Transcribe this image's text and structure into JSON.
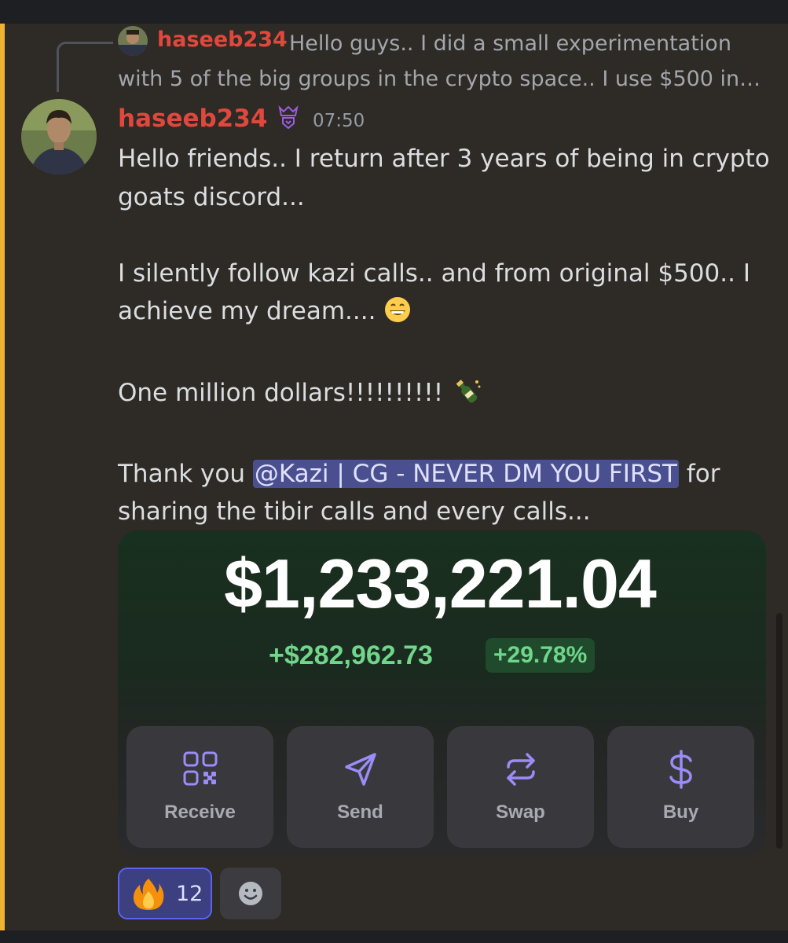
{
  "reply": {
    "author": "haseeb234",
    "text": "Hello guys.. I did a small experimentation with 5 of the big groups in the crypto space.. I use $500 in…"
  },
  "message": {
    "author": "haseeb234",
    "time": "07:50",
    "line1": "Hello friends.. I return after 3 years of being in crypto goats discord...",
    "line2": "I silently follow kazi calls.. and from original $500.. I achieve my dream....",
    "line2_emoji": "😄",
    "line3": "One million dollars!!!!!!!!!!",
    "line3_emoji": "🍾",
    "line4_before": "Thank you ",
    "mention": "@Kazi | CG - NEVER DM YOU FIRST",
    "line4_after": " for sharing the tibir calls and every calls..."
  },
  "wallet": {
    "balance": "$1,233,221.04",
    "change": "+$282,962.73",
    "change_pct": "+29.78%",
    "actions": [
      {
        "label": "Receive",
        "icon": "qr-icon"
      },
      {
        "label": "Send",
        "icon": "send-icon"
      },
      {
        "label": "Swap",
        "icon": "swap-icon"
      },
      {
        "label": "Buy",
        "icon": "dollar-icon"
      }
    ]
  },
  "reactions": [
    {
      "emoji": "fire-icon",
      "count": "12"
    }
  ],
  "colors": {
    "username": "#e0483d",
    "mention_bar": "#f0b232",
    "accent": "#6fd68a",
    "icon_purple": "#9b8cf7"
  }
}
